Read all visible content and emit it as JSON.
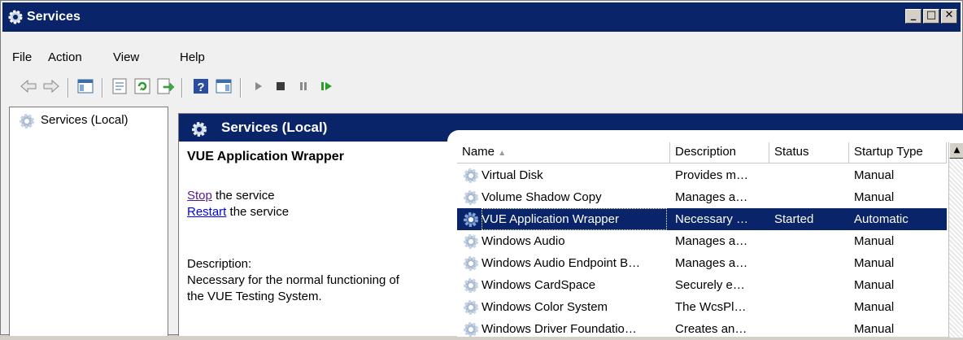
{
  "window": {
    "title": "Services"
  },
  "menu": [
    "File",
    "Action",
    "View",
    "Help"
  ],
  "toolbar": {
    "icons": [
      "back-arrow-icon",
      "forward-arrow-icon",
      "show-hide-console-tree-icon",
      "properties-icon",
      "refresh-icon",
      "export-list-icon",
      "help-icon",
      "show-hide-action-pane-icon",
      "start-service-icon",
      "stop-service-icon",
      "pause-service-icon",
      "resume-service-icon"
    ]
  },
  "tree": {
    "root_label": "Services (Local)"
  },
  "header": {
    "title": "Services (Local)"
  },
  "detail": {
    "service_name": "VUE Application Wrapper",
    "stop_link": "Stop",
    "stop_suffix": " the service",
    "restart_link": "Restart",
    "restart_suffix": " the service",
    "description_label": "Description:",
    "description_line1": "Necessary for the normal functioning of",
    "description_line2": "the VUE Testing System."
  },
  "list": {
    "columns": [
      "Name",
      "Description",
      "Status",
      "Startup Type"
    ],
    "rows": [
      {
        "name": "Virtual Disk",
        "description": "Provides m…",
        "status": "",
        "startup": "Manual",
        "selected": false
      },
      {
        "name": "Volume Shadow Copy",
        "description": "Manages a…",
        "status": "",
        "startup": "Manual",
        "selected": false
      },
      {
        "name": "VUE Application Wrapper",
        "description": "Necessary …",
        "status": "Started",
        "startup": "Automatic",
        "selected": true
      },
      {
        "name": "Windows Audio",
        "description": "Manages a…",
        "status": "",
        "startup": "Manual",
        "selected": false
      },
      {
        "name": "Windows Audio Endpoint B…",
        "description": "Manages a…",
        "status": "",
        "startup": "Manual",
        "selected": false
      },
      {
        "name": "Windows CardSpace",
        "description": "Securely e…",
        "status": "",
        "startup": "Manual",
        "selected": false
      },
      {
        "name": "Windows Color System",
        "description": "The WcsPl…",
        "status": "",
        "startup": "Manual",
        "selected": false
      },
      {
        "name": "Windows Driver Foundatio…",
        "description": "Creates an…",
        "status": "",
        "startup": "Manual",
        "selected": false
      }
    ]
  },
  "colors": {
    "title_bar": "#0a246a",
    "selection": "#0a246a",
    "link_visited": "#551a8b",
    "link": "#0000ee"
  }
}
